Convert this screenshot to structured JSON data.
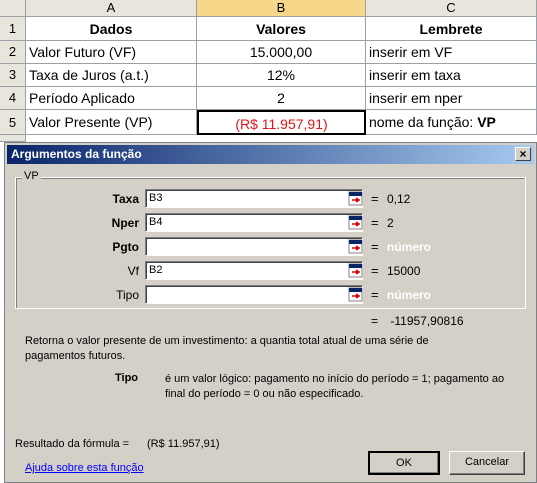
{
  "sheet": {
    "col_headers": [
      "A",
      "B",
      "C"
    ],
    "rows": [
      {
        "num": "1",
        "a": "Dados",
        "b": "Valores",
        "c": "Lembrete"
      },
      {
        "num": "2",
        "a": "Valor Futuro (VF)",
        "b": "15.000,00",
        "c": "inserir em VF"
      },
      {
        "num": "3",
        "a": "Taxa de Juros (a.t.)",
        "b": "12%",
        "c": "inserir em taxa"
      },
      {
        "num": "4",
        "a": "Período Aplicado",
        "b": "2",
        "c": "inserir em nper"
      },
      {
        "num": "5",
        "a": "Valor Presente (VP)",
        "b": "(R$ 11.957,91)",
        "c": "nome da função: ",
        "c_bold": "VP"
      }
    ]
  },
  "dialog": {
    "title": "Argumentos da função",
    "close": "×",
    "group_label": "VP",
    "args": [
      {
        "label": "Taxa",
        "value": "B3",
        "eq": "=",
        "result": "0,12"
      },
      {
        "label": "Nper",
        "value": "B4",
        "eq": "=",
        "result": "2"
      },
      {
        "label": "Pgto",
        "value": "",
        "eq": "=",
        "result": "número"
      },
      {
        "label": "Vf",
        "value": "B2",
        "eq": "=",
        "result": "15000"
      },
      {
        "label": "Tipo",
        "value": "",
        "eq": "=",
        "result": "número"
      }
    ],
    "total_eq": "=",
    "total_result": "-11957,90816",
    "description": "Retorna o valor presente de um investimento: a quantia total atual de uma série de pagamentos futuros.",
    "tipo_label": "Tipo",
    "tipo_description": "é um valor lógico: pagamento no início do período = 1; pagamento ao final do período = 0 ou não especificado.",
    "formula_result_label": "Resultado da fórmula =",
    "formula_result_value": "(R$ 11.957,91)",
    "help_link": "Ajuda sobre esta função",
    "ok_label": "OK",
    "cancel_label": "Cancelar"
  },
  "colors": {
    "red_value": "#e4141b",
    "titlebar": "#0a246a",
    "dialog_bg": "#d4d0c8"
  }
}
